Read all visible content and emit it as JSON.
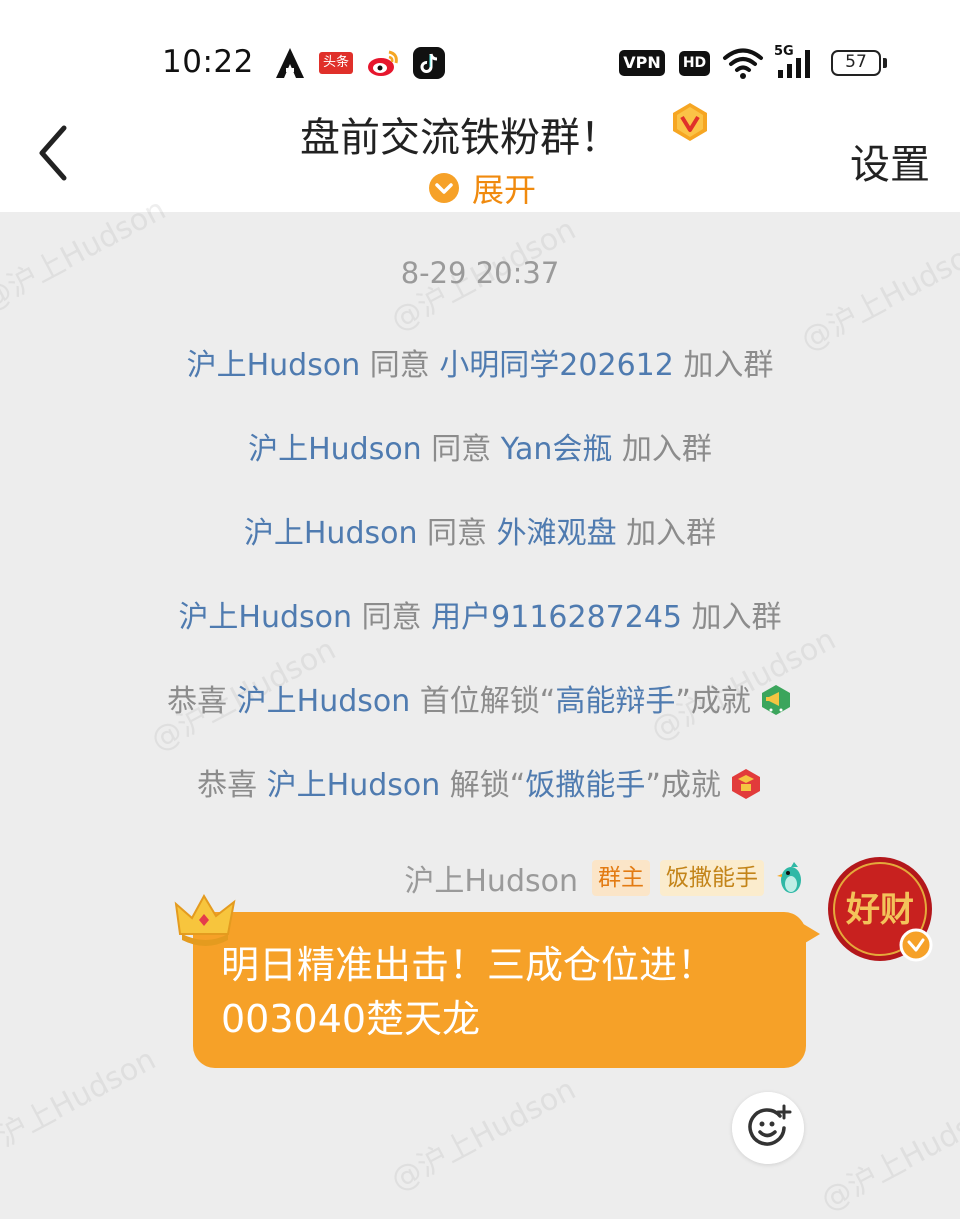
{
  "status_bar": {
    "time": "10:22",
    "toutiao_label": "头条",
    "vpn_label": "VPN",
    "hd_label": "HD",
    "network_label": "5G",
    "battery_level": "57"
  },
  "header": {
    "title": "盘前交流铁粉群！",
    "expand_label": "展开",
    "settings_label": "设置"
  },
  "chat": {
    "timestamp": "8-29 20:37",
    "system_messages": [
      {
        "prefix": "",
        "user1": "沪上Hudson",
        "mid": " 同意 ",
        "user2": "小明同学202612",
        "suffix": " 加入群"
      },
      {
        "prefix": "",
        "user1": "沪上Hudson",
        "mid": " 同意 ",
        "user2": "Yan会瓶",
        "suffix": " 加入群"
      },
      {
        "prefix": "",
        "user1": "沪上Hudson",
        "mid": " 同意 ",
        "user2": "外滩观盘",
        "suffix": " 加入群"
      },
      {
        "prefix": "",
        "user1": "沪上Hudson",
        "mid": " 同意 ",
        "user2": "用户9116287245",
        "suffix": " 加入群"
      }
    ],
    "achievements": [
      {
        "prefix": "恭喜 ",
        "user": "沪上Hudson",
        "text": " 首位解锁“",
        "name": "高能辩手",
        "suffix": "”成就"
      },
      {
        "prefix": "恭喜 ",
        "user": "沪上Hudson",
        "text": " 解锁“",
        "name": "饭撒能手",
        "suffix": "”成就"
      }
    ],
    "message": {
      "sender": "沪上Hudson",
      "role_tag": "群主",
      "achievement_tag": "饭撒能手",
      "avatar_text": "好财",
      "line1": "明日精准出击！三成仓位进！",
      "line2": "003040楚天龙"
    }
  },
  "watermark_text": "@沪上Hudson",
  "colors": {
    "accent_orange": "#f6a128",
    "link_blue": "#4f7bb0",
    "background": "#ededed"
  }
}
